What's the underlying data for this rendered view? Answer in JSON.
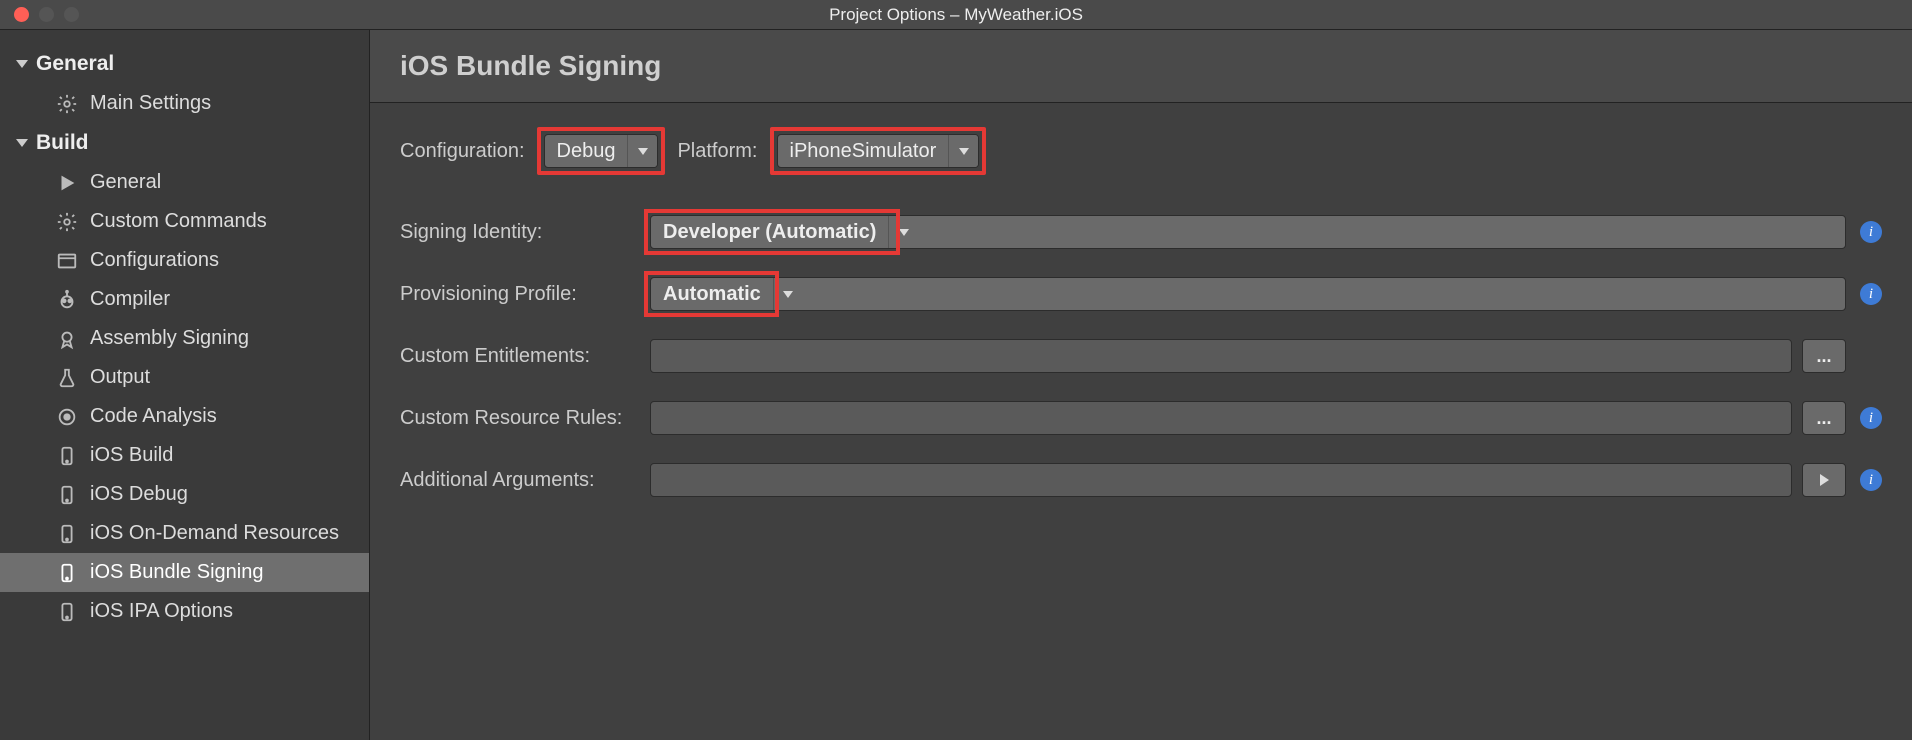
{
  "window": {
    "title": "Project Options – MyWeather.iOS"
  },
  "sidebar": {
    "sections": [
      {
        "label": "General",
        "items": [
          {
            "label": "Main Settings",
            "icon": "gear"
          }
        ]
      },
      {
        "label": "Build",
        "items": [
          {
            "label": "General",
            "icon": "play"
          },
          {
            "label": "Custom Commands",
            "icon": "gear"
          },
          {
            "label": "Configurations",
            "icon": "window"
          },
          {
            "label": "Compiler",
            "icon": "robot"
          },
          {
            "label": "Assembly Signing",
            "icon": "badge"
          },
          {
            "label": "Output",
            "icon": "flask"
          },
          {
            "label": "Code Analysis",
            "icon": "target"
          },
          {
            "label": "iOS Build",
            "icon": "device"
          },
          {
            "label": "iOS Debug",
            "icon": "device"
          },
          {
            "label": "iOS On-Demand Resources",
            "icon": "device"
          },
          {
            "label": "iOS Bundle Signing",
            "icon": "device",
            "selected": true
          },
          {
            "label": "iOS IPA Options",
            "icon": "device"
          }
        ]
      }
    ]
  },
  "panel": {
    "title": "iOS Bundle Signing",
    "configuration_label": "Configuration:",
    "configuration_value": "Debug",
    "platform_label": "Platform:",
    "platform_value": "iPhoneSimulator",
    "signing_identity_label": "Signing Identity:",
    "signing_identity_value": "Developer (Automatic)",
    "provisioning_profile_label": "Provisioning Profile:",
    "provisioning_profile_value": "Automatic",
    "custom_entitlements_label": "Custom Entitlements:",
    "custom_entitlements_value": "",
    "custom_resource_rules_label": "Custom Resource Rules:",
    "custom_resource_rules_value": "",
    "additional_arguments_label": "Additional Arguments:",
    "additional_arguments_value": "",
    "browse_button": "...",
    "info_glyph": "i"
  }
}
